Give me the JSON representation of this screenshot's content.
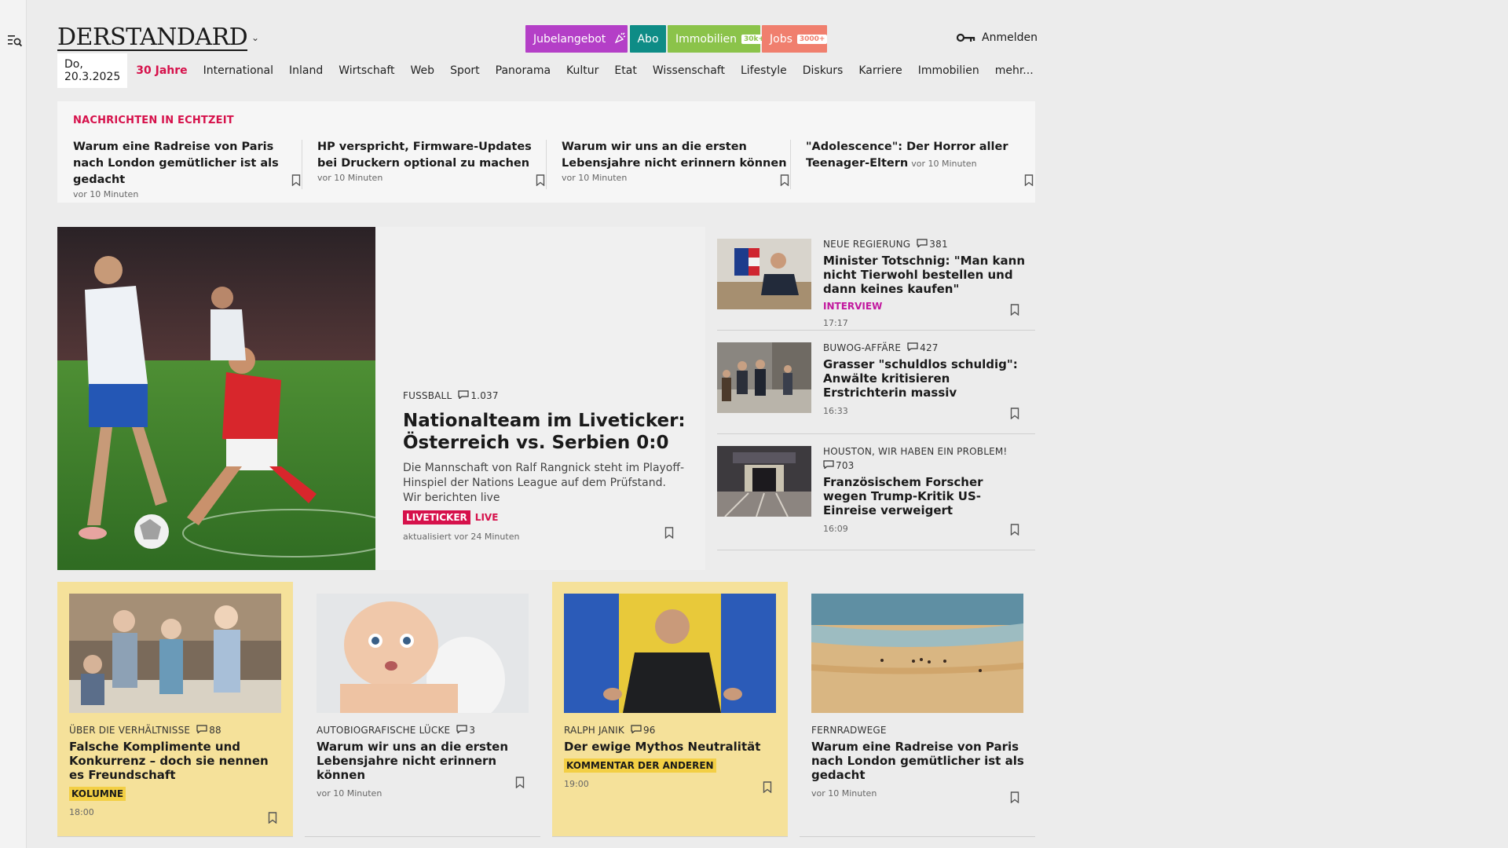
{
  "header": {
    "logo": "DERSTANDARD",
    "promos": {
      "jubel": "Jubelangebot",
      "abo": "Abo",
      "immo": "Immobilien",
      "immo_tag": "30k+",
      "jobs": "Jobs",
      "jobs_tag": "3000+"
    },
    "login": "Anmelden"
  },
  "nav": {
    "date": "Do, 20.3.2025",
    "items": [
      "30 Jahre",
      "International",
      "Inland",
      "Wirtschaft",
      "Web",
      "Sport",
      "Panorama",
      "Kultur",
      "Etat",
      "Wissenschaft",
      "Lifestyle",
      "Diskurs",
      "Karriere",
      "Immobilien",
      "mehr..."
    ]
  },
  "realtime": {
    "title": "NACHRICHTEN IN ECHTZEIT",
    "items": [
      {
        "headline": "Warum eine Radreise von Paris nach London gemütlicher ist als gedacht",
        "time": "vor 10 Minuten"
      },
      {
        "headline": "HP verspricht, Firmware-Updates bei Druckern optional zu machen",
        "time": "vor 10 Minuten"
      },
      {
        "headline": "Warum wir uns an die ersten Lebensjahre nicht erinnern können",
        "time": "vor 10 Minuten"
      },
      {
        "headline": "\"Adolescence\": Der Horror aller Teenager-Eltern",
        "time": "vor 10 Minuten"
      }
    ]
  },
  "hero": {
    "kicker": "FUSSBALL",
    "comments": "1.037",
    "title": "Nationalteam im Liveticker: Österreich vs. Serbien 0:0",
    "lead": "Die Mannschaft von Ralf Rangnick steht im Playoff-Hinspiel der Nations League auf dem Prüfstand. Wir berichten live",
    "badge": "LIVETICKER",
    "live": "LIVE",
    "time": "aktualisiert vor 24 Minuten"
  },
  "side": [
    {
      "kicker": "NEUE REGIERUNG",
      "comments": "381",
      "title": "Minister Totschnig: \"Man kann nicht Tierwohl bestellen und dann keines kaufen\"",
      "tag": "INTERVIEW",
      "time": "17:17"
    },
    {
      "kicker": "BUWOG-AFFÄRE",
      "comments": "427",
      "title": "Grasser \"schuldlos schuldig\": Anwälte kritisieren Erstrichterin massiv",
      "tag": "",
      "time": "16:33"
    },
    {
      "kicker": "HOUSTON, WIR HABEN EIN PROBLEM!",
      "comments": "703",
      "title": "Französischem Forscher wegen Trump-Kritik US-Einreise verweigert",
      "tag": "",
      "time": "16:09"
    }
  ],
  "cards": [
    {
      "kicker": "ÜBER DIE VERHÄLTNISSE",
      "comments": "88",
      "title": "Falsche Komplimente und Konkurrenz – doch sie nennen es Freundschaft",
      "label": "KOLUMNE",
      "time": "18:00"
    },
    {
      "kicker": "AUTOBIOGRAFISCHE LÜCKE",
      "comments": "3",
      "title": "Warum wir uns an die ersten Lebensjahre nicht erinnern können",
      "label": "",
      "time": "vor 10 Minuten"
    },
    {
      "kicker": "RALPH JANIK",
      "comments": "96",
      "title": "Der ewige Mythos Neutralität",
      "label": "KOMMENTAR DER ANDEREN",
      "time": "19:00"
    },
    {
      "kicker": "FERNRADWEGE",
      "comments": "",
      "title": "Warum eine Radreise von Paris nach London gemütlicher ist als gedacht",
      "label": "",
      "time": "vor 10 Minuten"
    }
  ],
  "colors": {
    "accent": "#d6114b",
    "interview": "#c2179e",
    "highlight": "#f5e19a",
    "jubel": "#b43fc7",
    "abo": "#0e8c86",
    "immo": "#8bc34a",
    "jobs": "#f07f6e"
  }
}
